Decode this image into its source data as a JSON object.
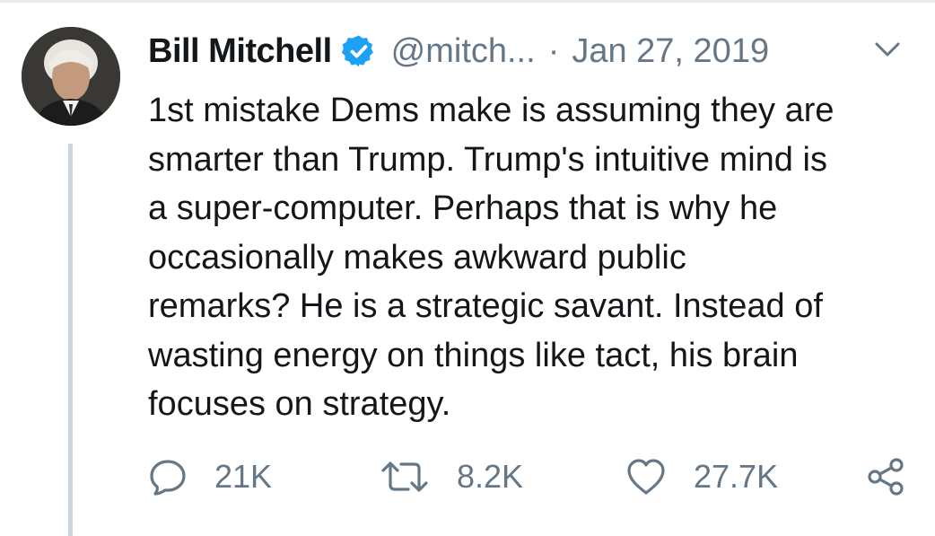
{
  "tweet": {
    "display_name": "Bill Mitchell",
    "handle": "@mitch...",
    "separator": "·",
    "date": "Jan 27, 2019",
    "text": "1st mistake Dems make is assuming they are\nsmarter than Trump. Trump's intuitive mind is\na super-computer. Perhaps that is why he\noccasionally makes awkward public\nremarks? He is a strategic savant. Instead of\nwasting energy on things like tact, his brain\nfocuses on strategy.",
    "verified": true
  },
  "actions": {
    "replies": "21K",
    "retweets": "8.2K",
    "likes": "27.7K"
  },
  "icons": {
    "reply": "reply-bubble-icon",
    "retweet": "retweet-arrows-icon",
    "like": "heart-icon",
    "share": "share-icon",
    "verified": "verified-badge-icon",
    "menu": "chevron-down-icon"
  },
  "colors": {
    "text": "#14171a",
    "secondary": "#657786",
    "verified": "#1da1f2",
    "thread_line": "#ccd6dd"
  }
}
